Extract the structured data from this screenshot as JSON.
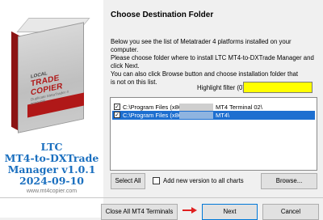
{
  "sidebar": {
    "logo_title": "TRADE COPIER",
    "logo_top": "LOCAL",
    "logo_sub": "Duplicate MetaTrader 4 accounts",
    "product_lines": [
      "LTC",
      "MT4-to-DXTrade",
      "Manager v1.0.1",
      "2024-09-10"
    ],
    "website": "www.mt4copier.com"
  },
  "header": {
    "title": "Choose Destination Folder"
  },
  "description": [
    "Below you see the list of Metatrader 4 platforms installed on your",
    "computer.",
    "Please choose folder where to install LTC MT4-to-DXTrade Manager and",
    "click Next.",
    "You can also click Browse button and choose installation folder that",
    "is not on this list."
  ],
  "highlight_filter": {
    "label": "Highlight filter (0):",
    "value": "",
    "color": "#ffff00"
  },
  "platforms": [
    {
      "path": "C:\\Program Files (x86)\\",
      "suffix": "MT4 Terminal 02\\",
      "checked": true,
      "selected": false
    },
    {
      "path": "C:\\Program Files (x86)\\",
      "suffix": "MT4\\",
      "checked": true,
      "selected": true
    }
  ],
  "buttons": {
    "select_all": "Select All",
    "add_new_version": "Add new version to all charts",
    "browse": "Browse...",
    "close_all": "Close All MT4 Terminals",
    "next": "Next",
    "cancel": "Cancel"
  },
  "colors": {
    "selection": "#1e6fd0",
    "product_text": "#1a6fbf",
    "accent_arrow": "#e02020"
  }
}
